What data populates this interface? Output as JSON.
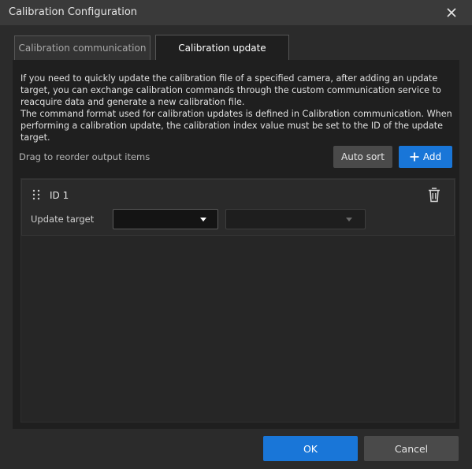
{
  "window": {
    "title": "Calibration Configuration",
    "close_icon": "close-icon"
  },
  "tabs": [
    {
      "label": "Calibration communication",
      "active": false
    },
    {
      "label": "Calibration update",
      "active": true
    }
  ],
  "description": {
    "line1": "If you need to quickly update the calibration file of a specified camera, after adding an update target, you can exchange calibration commands through the custom communication service to reacquire data and generate a new calibration file.",
    "line2": "The command format used for calibration updates is defined in Calibration communication. When performing a calibration update, the calibration index value must be set to the ID of the update target."
  },
  "toolbar": {
    "drag_hint": "Drag to reorder output items",
    "auto_sort_label": "Auto sort",
    "add_label": "Add"
  },
  "items": [
    {
      "id_label": "ID 1",
      "field_label": "Update target",
      "target_value": "",
      "sub_value": ""
    }
  ],
  "footer": {
    "ok_label": "OK",
    "cancel_label": "Cancel"
  },
  "colors": {
    "accent": "#1976d8",
    "background": "#2b2b2b",
    "panel": "#1f1f1f"
  }
}
